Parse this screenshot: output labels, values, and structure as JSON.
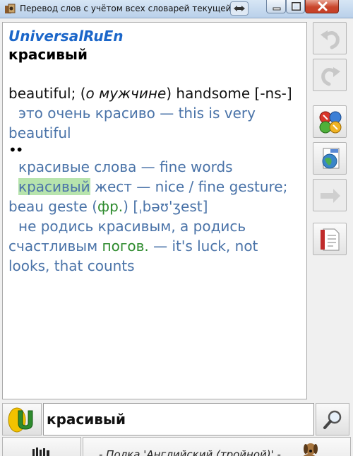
{
  "window": {
    "title": "Перевод слов с учётом всех словарей текущей п..."
  },
  "article": {
    "dictionary_name": "UniversalRuEn",
    "headword": "красивый",
    "translation_main": "beautiful; (",
    "translation_note": "о мужчине",
    "translation_rest": ") handsome [-ns-]",
    "ex1": "это очень красиво — this is very beautiful",
    "bullet": "••",
    "ex2": "красивые слова — fine words",
    "ex3_highlight": "красивый",
    "ex3_rest": " жест — nice / fine gesture; beau geste (",
    "ex3_label": "фр.",
    "ex3_end": ") [ˌbəʊ'ʒest]",
    "ex4_start": "не родись красивым, а родись счастливым ",
    "ex4_label": "погов.",
    "ex4_end": " — it's luck, not looks, that counts"
  },
  "toolbar": {
    "icons": [
      "undo-icon",
      "redo-icon",
      "all-dictionaries-icon",
      "web-html-icon",
      "forward-arrow-icon",
      "document-icon"
    ]
  },
  "search": {
    "value": "красивый"
  },
  "shelf": {
    "label": "- Полка 'Английский (тройной)' -"
  },
  "colors": {
    "dictionary_name": "#1b66c9",
    "example_text": "#4a73a8",
    "grammar_label": "#2e8b2e",
    "highlight": "#b7e4ad"
  }
}
